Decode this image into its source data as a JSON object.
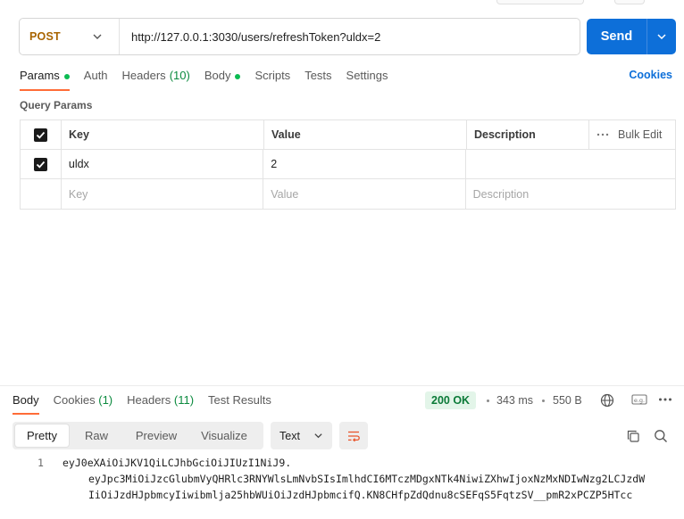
{
  "request": {
    "method": "POST",
    "url": "http://127.0.0.1:3030/users/refreshToken?uldx=2",
    "send_label": "Send"
  },
  "request_tabs": [
    {
      "label": "Params",
      "dot": true,
      "active": true
    },
    {
      "label": "Auth"
    },
    {
      "label": "Headers",
      "count": "(10)"
    },
    {
      "label": "Body",
      "dot": true
    },
    {
      "label": "Scripts"
    },
    {
      "label": "Tests"
    },
    {
      "label": "Settings"
    }
  ],
  "cookies_label": "Cookies",
  "query_params": {
    "section_label": "Query Params",
    "headers": {
      "key": "Key",
      "value": "Value",
      "description": "Description",
      "bulk_edit": "Bulk Edit"
    },
    "rows": [
      {
        "checked": true,
        "key": "uldx",
        "value": "2",
        "description": ""
      }
    ],
    "placeholders": {
      "key": "Key",
      "value": "Value",
      "description": "Description"
    }
  },
  "response": {
    "tabs": [
      {
        "label": "Body",
        "active": true
      },
      {
        "label": "Cookies",
        "count": "(1)"
      },
      {
        "label": "Headers",
        "count": "(11)"
      },
      {
        "label": "Test Results"
      }
    ],
    "status": "200 OK",
    "time": "343 ms",
    "size": "550 B",
    "view_modes": [
      "Pretty",
      "Raw",
      "Preview",
      "Visualize"
    ],
    "active_view": "Pretty",
    "format": "Text",
    "line_number": "1",
    "body_lines": [
      "eyJ0eXAiOiJKV1QiLCJhbGciOiJIUzI1NiJ9.",
      "eyJpc3MiOiJzcGlubmVyQHRlc3RNYWlsLmNvbSIsImlhdCI6MTczMDgxNTk4NiwiZXhwIjoxNzMxNDIwNzg2LCJzdW",
      "IiOiJzdHJpbmcyIiwibmlja25hbWUiOiJzdHJpbmcifQ.KN8CHfpZdQdnu8cSEFqS5FqtzSV__pmR2xPCZP5HTcc"
    ]
  },
  "colors": {
    "accent": "#ff6c37",
    "send": "#0d6fd9",
    "method_post": "#a86400",
    "status_ok": "#0b7a38"
  }
}
